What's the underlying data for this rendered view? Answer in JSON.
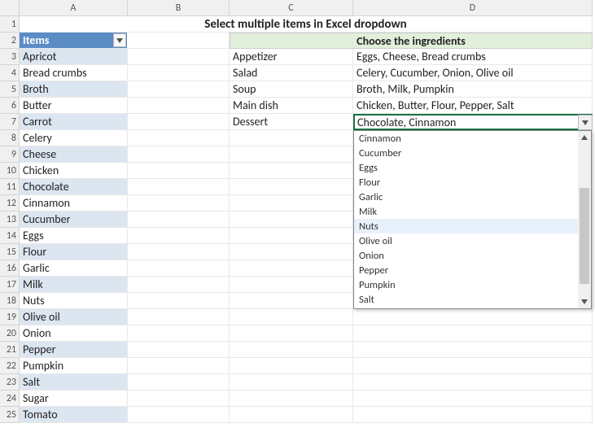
{
  "columns": [
    "A",
    "B",
    "C",
    "D"
  ],
  "title": "Select multiple items in Excel dropdown",
  "headers": {
    "items": "Items",
    "choose": "Choose the ingredients"
  },
  "items": [
    "Apricot",
    "Bread crumbs",
    "Broth",
    "Butter",
    "Carrot",
    "Celery",
    "Cheese",
    "Chicken",
    "Chocolate",
    "Cinnamon",
    "Cucumber",
    "Eggs",
    "Flour",
    "Garlic",
    "Milk",
    "Nuts",
    "Olive oil",
    "Onion",
    "Pepper",
    "Pumpkin",
    "Salt",
    "Sugar",
    "Tomato"
  ],
  "dishes": [
    {
      "name": "Appetizer",
      "ingredients": "Eggs, Cheese, Bread crumbs"
    },
    {
      "name": "Salad",
      "ingredients": "Celery, Cucumber, Onion, Olive oil"
    },
    {
      "name": "Soup",
      "ingredients": "Broth, Milk, Pumpkin"
    },
    {
      "name": "Main dish",
      "ingredients": "Chicken, Butter, Flour, Pepper, Salt"
    },
    {
      "name": "Dessert",
      "ingredients": "Chocolate, Cinnamon"
    }
  ],
  "dropdown": {
    "options": [
      "Cinnamon",
      "Cucumber",
      "Eggs",
      "Flour",
      "Garlic",
      "Milk",
      "Nuts",
      "Olive oil",
      "Onion",
      "Pepper",
      "Pumpkin",
      "Salt"
    ],
    "hovered_index": 6
  },
  "row_count": 25,
  "chart_data": {
    "type": "table",
    "title": "Select multiple items in Excel dropdown",
    "columns_A": {
      "header": "Items",
      "rows": [
        "Apricot",
        "Bread crumbs",
        "Broth",
        "Butter",
        "Carrot",
        "Celery",
        "Cheese",
        "Chicken",
        "Chocolate",
        "Cinnamon",
        "Cucumber",
        "Eggs",
        "Flour",
        "Garlic",
        "Milk",
        "Nuts",
        "Olive oil",
        "Onion",
        "Pepper",
        "Pumpkin",
        "Salt",
        "Sugar",
        "Tomato"
      ]
    },
    "columns_CD": {
      "header": "Choose the ingredients",
      "rows": [
        [
          "Appetizer",
          "Eggs, Cheese, Bread crumbs"
        ],
        [
          "Salad",
          "Celery, Cucumber, Onion, Olive oil"
        ],
        [
          "Soup",
          "Broth, Milk, Pumpkin"
        ],
        [
          "Main dish",
          "Chicken, Butter, Flour, Pepper, Salt"
        ],
        [
          "Dessert",
          "Chocolate, Cinnamon"
        ]
      ]
    },
    "active_cell": "D7",
    "dropdown_visible_options": [
      "Cinnamon",
      "Cucumber",
      "Eggs",
      "Flour",
      "Garlic",
      "Milk",
      "Nuts",
      "Olive oil",
      "Onion",
      "Pepper",
      "Pumpkin",
      "Salt"
    ]
  }
}
